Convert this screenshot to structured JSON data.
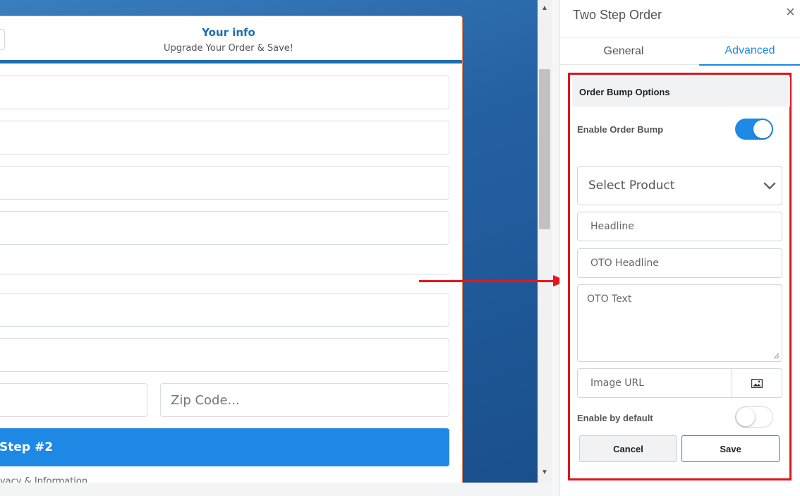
{
  "form": {
    "title": "Your info",
    "subtitle": "Upgrade Your Order & Save!",
    "zip_placeholder": "Zip Code...",
    "step_button": "Step #2",
    "privacy": "rivacy & Information"
  },
  "panel": {
    "title": "Two Step Order",
    "close": "×",
    "tabs": [
      "General",
      "Advanced"
    ],
    "active_tab": "Advanced",
    "section_title": "Order Bump Options",
    "enable_order_bump_label": "Enable Order Bump",
    "enable_order_bump": true,
    "select_product": "Select Product",
    "headline_placeholder": "Headline",
    "oto_headline_placeholder": "OTO Headline",
    "oto_text_placeholder": "OTO Text",
    "image_url_placeholder": "Image URL",
    "enable_by_default_label": "Enable by default",
    "enable_by_default": false,
    "cancel": "Cancel",
    "save": "Save"
  },
  "colors": {
    "accent": "#1e88e5",
    "highlight_border": "#e0141c",
    "brand_blue": "#1b6fb0"
  },
  "icons": [
    "close-icon",
    "chevron-down-icon",
    "image-icon",
    "resize-handle-icon",
    "scroll-up-icon",
    "scroll-down-icon",
    "red-arrow-icon"
  ]
}
